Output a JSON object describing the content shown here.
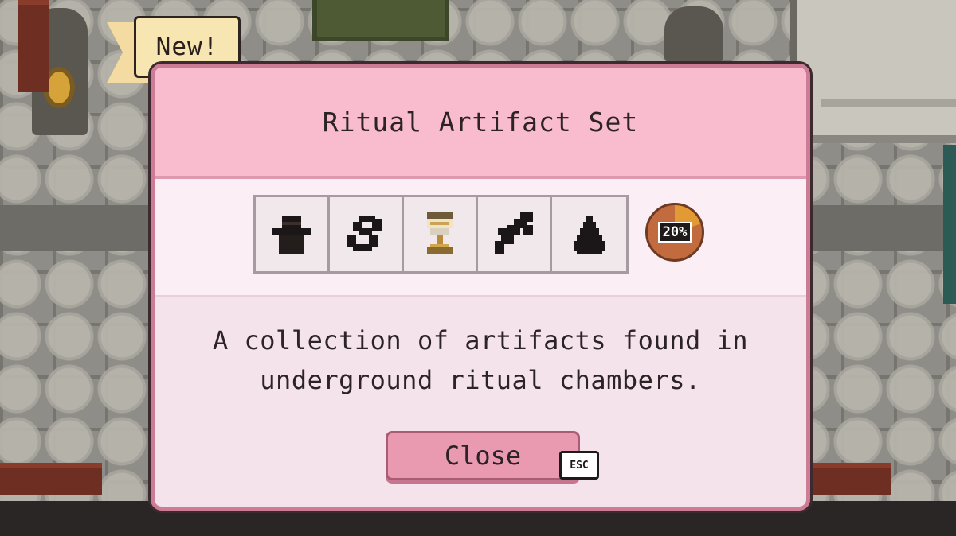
{
  "badge": {
    "text": "New!"
  },
  "dialog": {
    "title": "Ritual Artifact Set",
    "description_line1": "A collection of artifacts found in",
    "description_line2": "underground ritual chambers.",
    "close_label": "Close",
    "close_hotkey": "ESC"
  },
  "artifacts": [
    {
      "icon": "hat-silhouette-icon",
      "status": "locked"
    },
    {
      "icon": "rope-coil-silhouette-icon",
      "status": "locked"
    },
    {
      "icon": "chalice-icon",
      "status": "collected"
    },
    {
      "icon": "dagger-silhouette-icon",
      "status": "locked"
    },
    {
      "icon": "stone-pyramid-silhouette-icon",
      "status": "locked"
    }
  ],
  "progress": {
    "label": "20%",
    "fraction": 0.2
  },
  "colors": {
    "header": "#f8bcce",
    "dialog_body": "#f4e3ea",
    "button": "#e99ab1",
    "progress_fill": "#e29a35",
    "progress_empty": "#c16b3e",
    "silhouette": "#1b1718"
  }
}
